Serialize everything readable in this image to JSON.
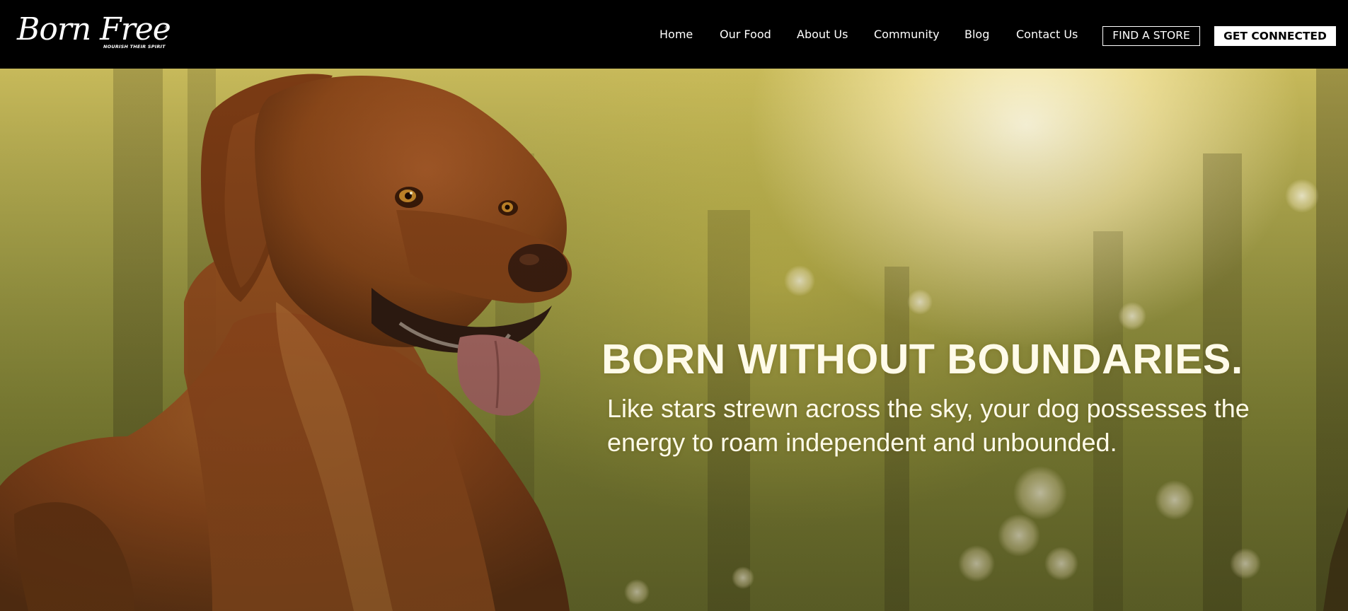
{
  "header": {
    "logo_text": "Born Free",
    "logo_tagline": "NOURISH THEIR SPIRIT",
    "logo_mark": "®",
    "nav": [
      {
        "label": "Home"
      },
      {
        "label": "Our Food"
      },
      {
        "label": "About Us"
      },
      {
        "label": "Community"
      },
      {
        "label": "Blog"
      },
      {
        "label": "Contact Us"
      }
    ],
    "find_store_label": "FIND A STORE",
    "get_connected_label": "GET CONNECTED"
  },
  "hero": {
    "title": "BORN WITHOUT BOUNDARIES.",
    "subtitle": "Like stars strewn across the sky, your dog possesses the energy to roam independent and unbounded."
  },
  "colors": {
    "header_bg": "#000000",
    "text_light": "#ffffff",
    "hero_text": "#fffbe9",
    "dog_fur": "#9b4a1c",
    "forest_green": "#8c8f3a",
    "sun_glow": "#fff4cf"
  }
}
